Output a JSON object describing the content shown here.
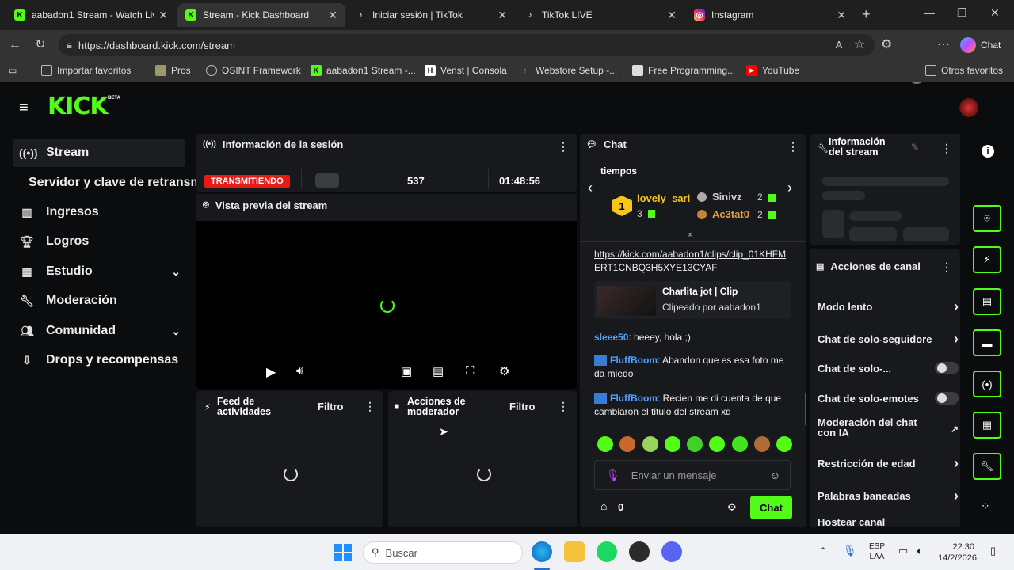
{
  "browser": {
    "tabs": [
      {
        "title": "aabadon1 Stream - Watch Live o",
        "icon": "kick-favicon"
      },
      {
        "title": "Stream - Kick Dashboard",
        "icon": "kick-favicon"
      },
      {
        "title": "Iniciar sesión | TikTok",
        "icon": "tiktok-favicon"
      },
      {
        "title": "TikTok LIVE",
        "icon": "tiktok-favicon"
      },
      {
        "title": "Instagram",
        "icon": "instagram-favicon"
      }
    ],
    "url": "https://dashboard.kick.com/stream",
    "copilot_label": "Chat",
    "bookmarks": [
      "Importar favoritos",
      "Pros",
      "OSINT Framework",
      "aabadon1 Stream -...",
      "Venst | Consola",
      "Webstore Setup -...",
      "Free Programming...",
      "YouTube"
    ],
    "other_favorites": "Otros favoritos"
  },
  "kick": {
    "logo": "KICK",
    "beta": "BETA",
    "sidebar": [
      {
        "label": "Stream",
        "icon": "stream-icon",
        "active": true
      },
      {
        "label": "Servidor y clave de retransm",
        "icon": "",
        "active": false
      },
      {
        "label": "Ingresos",
        "icon": "chart-icon",
        "active": false
      },
      {
        "label": "Logros",
        "icon": "trophy-icon",
        "active": false
      },
      {
        "label": "Estudio",
        "icon": "studio-icon",
        "active": false
      },
      {
        "label": "Moderación",
        "icon": "wrench-icon",
        "active": false
      },
      {
        "label": "Comunidad",
        "icon": "community-icon",
        "active": false
      },
      {
        "label": "Drops y recompensas",
        "icon": "gift-icon",
        "active": false
      }
    ],
    "session": {
      "title": "Información de la sesión",
      "status": "TRANSMITIENDO",
      "viewers": "537",
      "duration": "01:48:56"
    },
    "preview": {
      "title": "Vista previa del stream"
    },
    "feed": {
      "title": "Feed de actividades",
      "filter": "Filtro"
    },
    "modactions": {
      "title": "Acciones de moderador",
      "filter": "Filtro"
    },
    "chat": {
      "title": "Chat",
      "leaderboard_heading": "tiempos",
      "leader1": {
        "rank": "1",
        "name": "lovely_sari",
        "count": "3"
      },
      "leader2": {
        "name": "Sinivz",
        "count": "2"
      },
      "leader3": {
        "name": "Ac3tat0",
        "count": "2"
      },
      "clip_link": "https://kick.com/aabadon1/clips/clip_01KHFMERT1CNBQ3H5XYE13CYAF",
      "clip_title": "Charlita jot | Clip",
      "clip_by": "Clipeado por aabadon1",
      "messages": [
        {
          "user": "sleee50",
          "text": ": heeey, hola ;)"
        },
        {
          "user": "FluffBoom",
          "text": ": Abandon que es esa foto me da miedo"
        },
        {
          "user": "FluffBoom",
          "text": ": Recien me di cuenta de que cambiaron el titulo del stream xd"
        }
      ],
      "input_placeholder": "Enviar un mensaje",
      "points": "0",
      "send": "Chat"
    },
    "streaminfo": {
      "title": "Información del stream"
    },
    "channel_actions": {
      "title": "Acciones de canal",
      "items": [
        {
          "label": "Modo lento",
          "control": "chevron"
        },
        {
          "label": "Chat de solo-seguidore",
          "control": "chevron"
        },
        {
          "label": "Chat de solo-...",
          "control": "toggle"
        },
        {
          "label": "Chat de solo-emotes",
          "control": "toggle"
        },
        {
          "label": "Moderación del chat con IA",
          "control": "external"
        },
        {
          "label": "Restricción de edad",
          "control": "chevron"
        },
        {
          "label": "Palabras baneadas",
          "control": "chevron"
        },
        {
          "label": "Hostear canal",
          "control": "none"
        }
      ]
    }
  },
  "taskbar": {
    "search": "Buscar",
    "lang1": "ESP",
    "lang2": "LAA",
    "time": "22:30",
    "date": "14/2/2026"
  },
  "colors": {
    "kick_green": "#53fc18",
    "live_red": "#e91916",
    "username_blue": "#4fa3ff",
    "gold": "#f5c518"
  }
}
